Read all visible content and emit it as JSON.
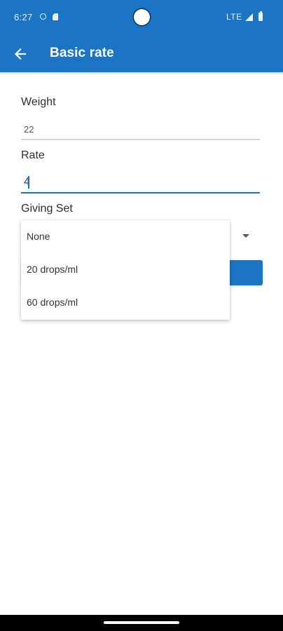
{
  "status_bar": {
    "time": "6:27",
    "network": "LTE",
    "icons": [
      "clock-icon",
      "sim-card-icon",
      "signal-icon",
      "battery-icon"
    ]
  },
  "app_bar": {
    "title": "Basic rate",
    "back_icon": "arrow-back-icon",
    "color": "#1b75c4"
  },
  "form": {
    "weight": {
      "label": "Weight",
      "value": "22"
    },
    "rate": {
      "label": "Rate",
      "value": "4"
    },
    "giving_set": {
      "label": "Giving Set",
      "options": [
        "None",
        "20 drops/ml",
        "60 drops/ml"
      ],
      "dropdown_icon": "arrow-drop-down-icon"
    },
    "accent_color": "#1b75c4"
  }
}
